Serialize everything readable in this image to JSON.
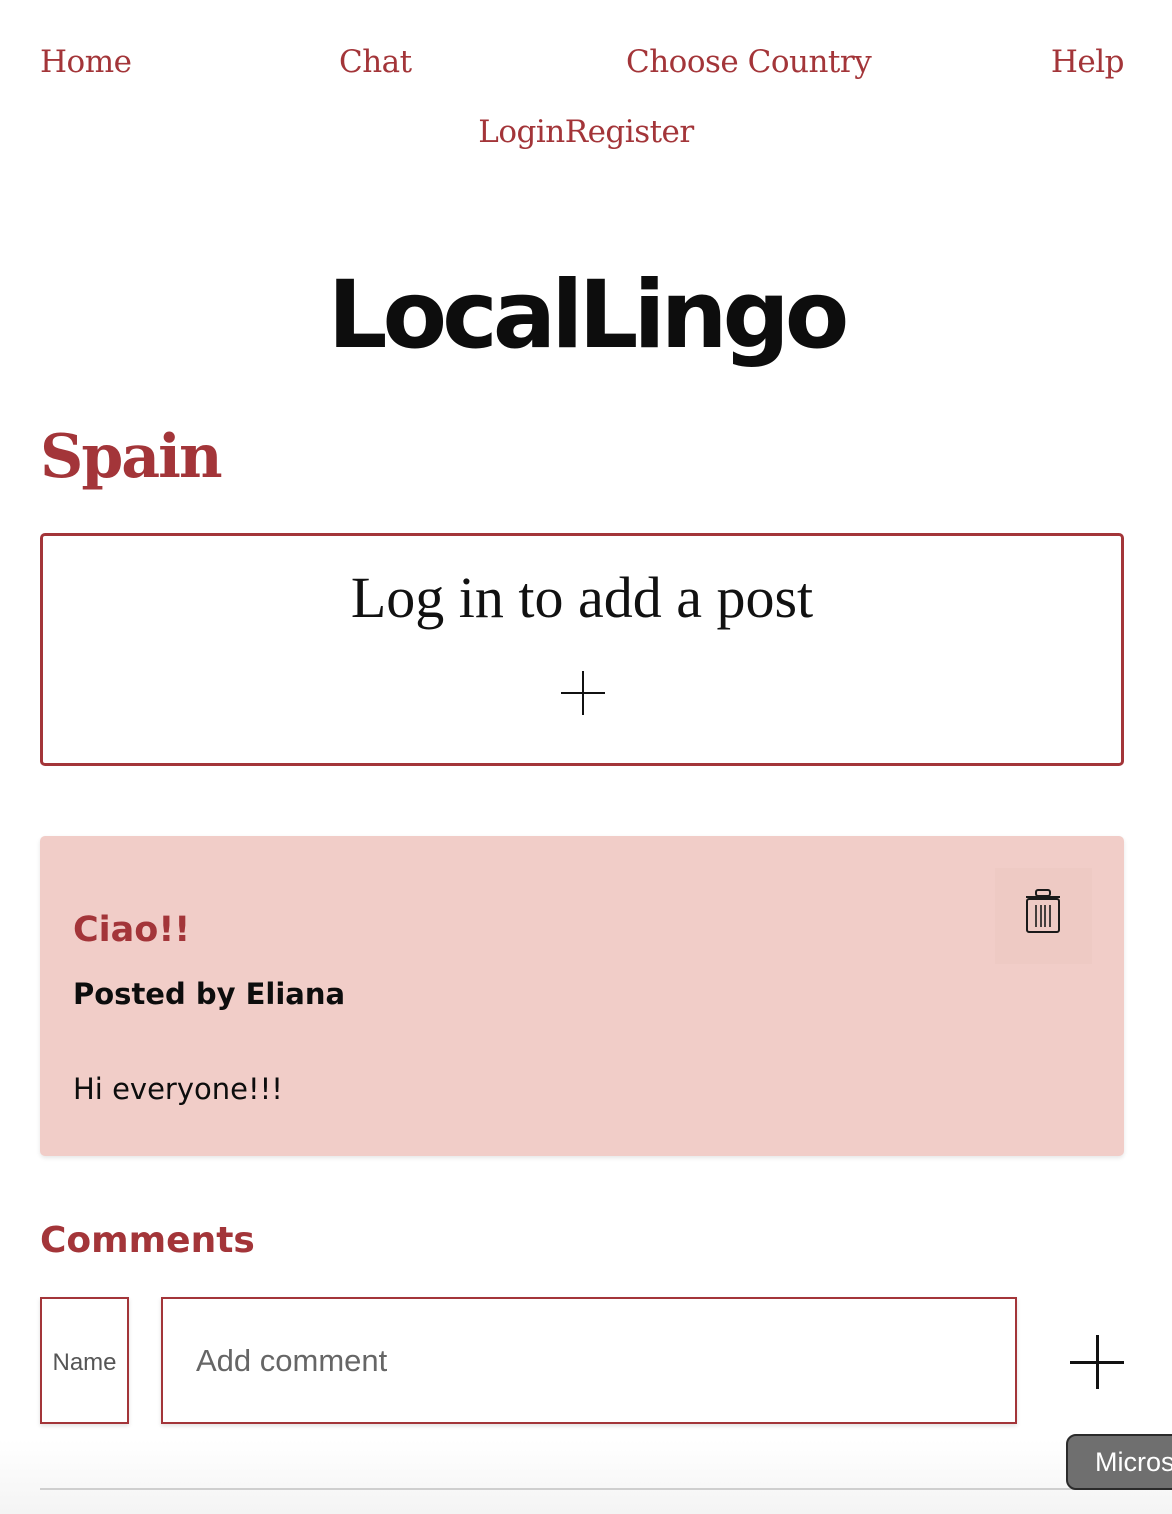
{
  "nav": {
    "home": "Home",
    "chat": "Chat",
    "choose_country": "Choose Country",
    "help": "Help",
    "login": "Login",
    "register": "Register"
  },
  "brand": "LocalLingo",
  "country": "Spain",
  "add_post": {
    "label": "Log in to add a post",
    "icon": "plus-icon"
  },
  "post": {
    "title": "Ciao!!",
    "author": "Posted by Eliana",
    "body": "Hi everyone!!!",
    "delete_icon": "trash-icon"
  },
  "comments": {
    "heading": "Comments",
    "name_label": "Name",
    "input_placeholder": "Add comment",
    "add_icon": "plus-icon"
  },
  "overlay_pill": "Micros",
  "colors": {
    "accent": "#a33539",
    "post_background": "#f1cdc8",
    "text": "#0d0d0d"
  }
}
